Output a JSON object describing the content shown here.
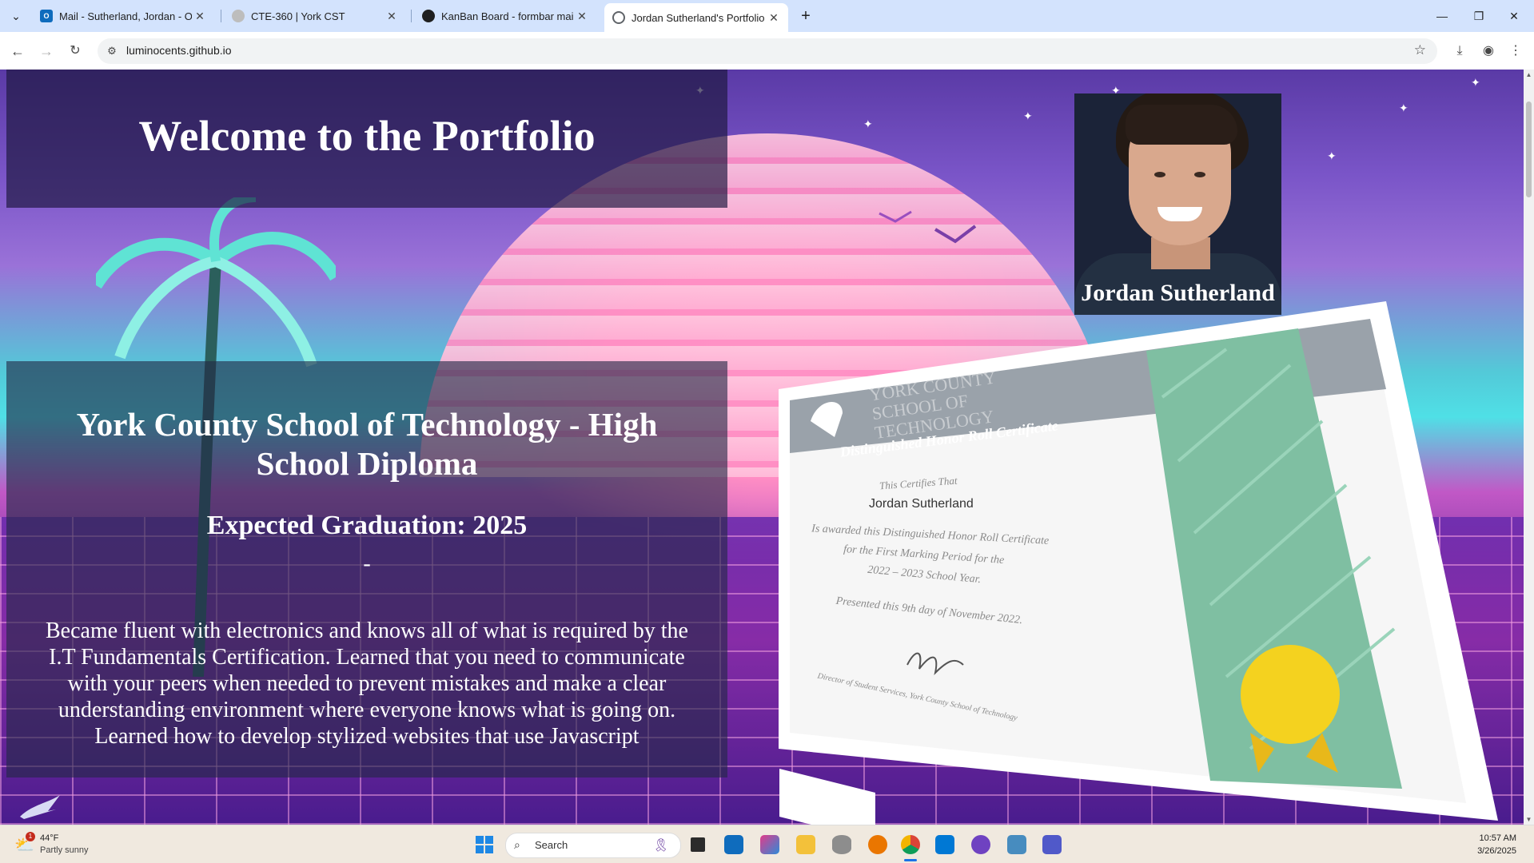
{
  "browser": {
    "tabs": [
      {
        "title": "Mail - Sutherland, Jordan - Outl",
        "icon": "outlook-icon",
        "color": "#0f6cbd"
      },
      {
        "title": "CTE-360 | York CST",
        "icon": "globe-icon",
        "color": "#8a8a8a"
      },
      {
        "title": "KanBan Board - formbar main",
        "icon": "github-icon",
        "color": "#1f1f1f"
      },
      {
        "title": "Jordan Sutherland's Portfolio",
        "icon": "globe-icon",
        "color": "#5f6368",
        "active": true
      }
    ],
    "url": "luminocents.github.io"
  },
  "page": {
    "welcome_title": "Welcome to the Portfolio",
    "profile_name": "Jordan Sutherland",
    "education": {
      "school": "York County School of Technology - High School Diploma",
      "graduation": "Expected Graduation: 2025",
      "divider": "-",
      "description": "Became fluent with electronics and knows all of what is required by the I.T Fundamentals Certification. Learned that you need to communicate with your peers when needed to prevent mistakes and make a clear understanding environment where everyone knows what is going on. Learned how to develop stylized websites that use Javascript"
    },
    "certificate": {
      "school": "YORK COUNTY SCHOOL OF TECHNOLOGY",
      "title": "Distinguished Honor Roll Certificate",
      "certifies": "This Certifies That",
      "recipient": "Jordan Sutherland",
      "line1": "Is awarded this Distinguished Honor Roll Certificate",
      "line2": "for the First Marking Period for the",
      "line3": "2022 – 2023 School Year.",
      "presented": "Presented this 9th day of November 2022.",
      "signer": "Director of Student Services, York County School of Technology"
    }
  },
  "taskbar": {
    "weather_temp": "44°F",
    "weather_condition": "Partly sunny",
    "weather_badge": "1",
    "search_label": "Search",
    "time": "10:57 AM",
    "date": "3/26/2025"
  }
}
